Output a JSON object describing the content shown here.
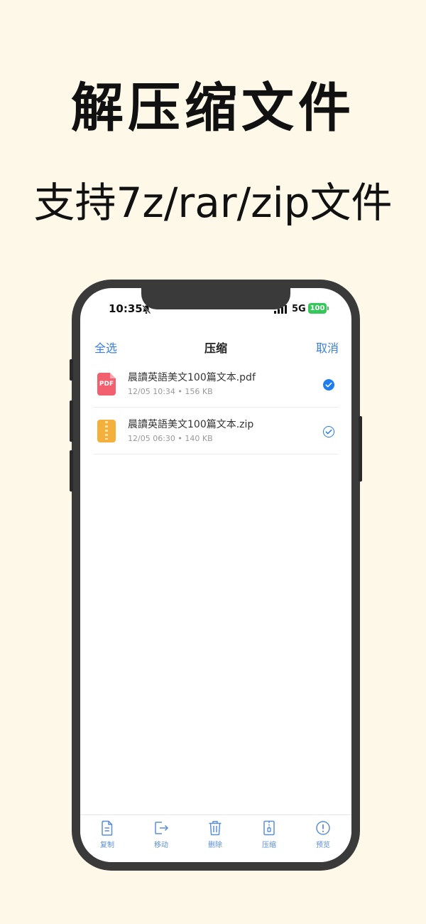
{
  "promo": {
    "headline": "解压缩文件",
    "subheadline": "支持7z/rar/zip文件"
  },
  "status_bar": {
    "time": "10:35",
    "network": "5G",
    "battery": "100"
  },
  "nav": {
    "left_label": "全选",
    "title": "压缩",
    "right_label": "取消"
  },
  "files": [
    {
      "name": "晨讀英語美文100篇文本.pdf",
      "meta": "12/05 10:34 • 156 KB",
      "type": "pdf-icon",
      "type_label": "PDF",
      "selected": true
    },
    {
      "name": "晨讀英語美文100篇文本.zip",
      "meta": "12/05 06:30 • 140 KB",
      "type": "zip-icon",
      "selected": true
    }
  ],
  "toolbar": {
    "items": [
      {
        "label": "复制",
        "icon": "copy-icon"
      },
      {
        "label": "移动",
        "icon": "move-icon"
      },
      {
        "label": "删除",
        "icon": "trash-icon"
      },
      {
        "label": "压缩",
        "icon": "zip-icon"
      },
      {
        "label": "预览",
        "icon": "info-icon"
      }
    ]
  },
  "colors": {
    "background": "#fdf8e8",
    "accent": "#1e7ef0",
    "battery": "#34c759",
    "pdf": "#f2606f",
    "zip": "#f3b03d"
  }
}
